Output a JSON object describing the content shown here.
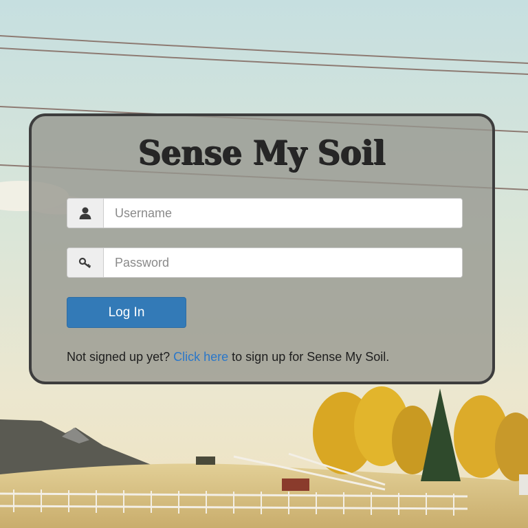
{
  "app": {
    "title": "Sense My Soil"
  },
  "login": {
    "username": {
      "value": "",
      "placeholder": "Username",
      "icon": "user-icon"
    },
    "password": {
      "value": "",
      "placeholder": "Password",
      "icon": "key-icon"
    },
    "submit_label": "Log In"
  },
  "signup": {
    "prefix": "Not signed up yet?",
    "link_label": "Click here",
    "suffix": "to sign up for Sense My Soil."
  },
  "colors": {
    "primary_button": "#337ab7",
    "link": "#2a77c9",
    "card_border": "#3d3d3d"
  }
}
